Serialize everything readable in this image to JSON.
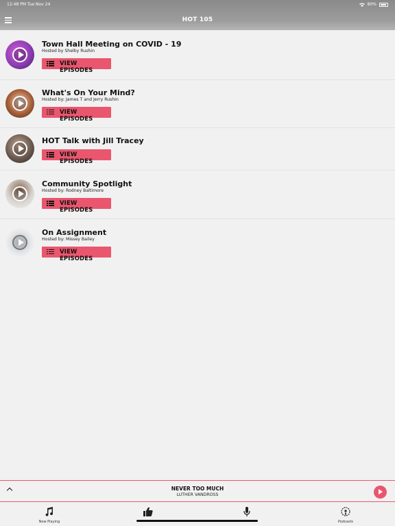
{
  "status_bar": {
    "time": "12:48 PM   Tue Nov 24",
    "battery": "80%"
  },
  "header": {
    "title": "HOT 105"
  },
  "podcasts": [
    {
      "title": "Town Hall Meeting on COVID - 19",
      "host": "Hosted by Shelby Rushin",
      "button": "VIEW EPISODES",
      "thumb_color": "#8e3db2"
    },
    {
      "title": "What's On Your Mind?",
      "host": "Hosted by: James T and Jerry Rushin",
      "button": "VIEW EPISODES",
      "thumb_color": "#8a4a33"
    },
    {
      "title": "HOT Talk with Jill Tracey",
      "host": "",
      "button": "VIEW EPISODES",
      "thumb_color": "#6b5a50"
    },
    {
      "title": "Community Spotlight",
      "host": "Hosted by: Rodney Baltimore",
      "button": "VIEW EPISODES",
      "thumb_color": "#d8d4d0"
    },
    {
      "title": "On Assignment",
      "host": "Hosted by: Missey Bailey",
      "button": "VIEW EPISODES",
      "thumb_color": "#e2e4e6"
    }
  ],
  "player": {
    "title": "NEVER TOO MUCH",
    "artist": "LUTHER VANDROSS"
  },
  "tabs": [
    {
      "label": "Now Playing",
      "icon": "music-note-icon"
    },
    {
      "label": "",
      "icon": "thumbs-up-icon"
    },
    {
      "label": "",
      "icon": "microphone-icon"
    },
    {
      "label": "Podcasts",
      "icon": "podcast-icon"
    }
  ],
  "colors": {
    "accent": "#e9566e",
    "header": "#9a9a9a",
    "background": "#f1f1f1"
  }
}
